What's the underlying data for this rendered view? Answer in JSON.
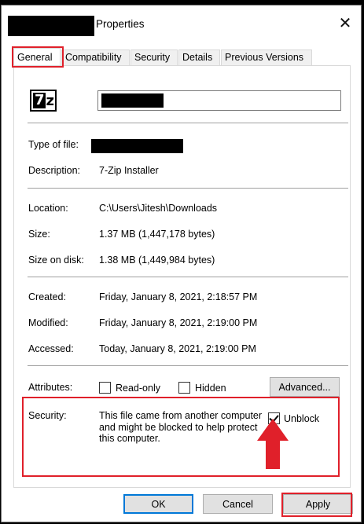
{
  "window": {
    "title": "Properties",
    "close_glyph": "✕"
  },
  "tabs": [
    {
      "label": "General",
      "active": true
    },
    {
      "label": "Compatibility"
    },
    {
      "label": "Security"
    },
    {
      "label": "Details"
    },
    {
      "label": "Previous Versions"
    }
  ],
  "file_icon": {
    "name": "7z-archive-icon",
    "text_7": "7",
    "text_z": "z"
  },
  "general": {
    "type_label": "Type of file:",
    "description_label": "Description:",
    "description_value": "7-Zip Installer",
    "location_label": "Location:",
    "location_value": "C:\\Users\\Jitesh\\Downloads",
    "size_label": "Size:",
    "size_value": "1.37 MB (1,447,178 bytes)",
    "size_on_disk_label": "Size on disk:",
    "size_on_disk_value": "1.38 MB (1,449,984 bytes)",
    "created_label": "Created:",
    "created_value": "Friday, January 8, 2021, 2:18:57 PM",
    "modified_label": "Modified:",
    "modified_value": "Friday, January 8, 2021, 2:19:00 PM",
    "accessed_label": "Accessed:",
    "accessed_value": "Today, January 8, 2021, 2:19:00 PM",
    "attributes_label": "Attributes:",
    "readonly_label": "Read-only",
    "readonly_checked": false,
    "hidden_label": "Hidden",
    "hidden_checked": false,
    "advanced_label": "Advanced...",
    "security_label": "Security:",
    "security_text": "This file came from another computer and might be blocked to help protect this computer.",
    "unblock_label": "Unblock",
    "unblock_checked": true
  },
  "buttons": {
    "ok": "OK",
    "cancel": "Cancel",
    "apply": "Apply"
  },
  "colors": {
    "highlight": "#e0202a",
    "arrow": "#e0202a",
    "default_button_border": "#0078d7"
  }
}
